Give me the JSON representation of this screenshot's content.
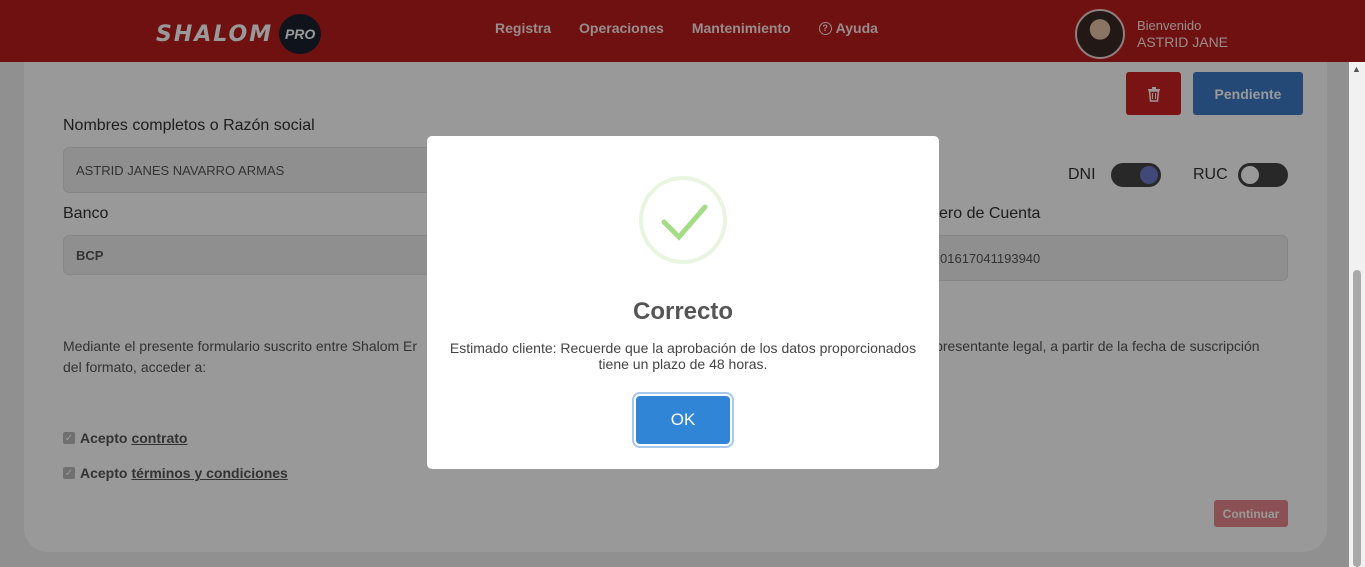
{
  "header": {
    "logo_text": "SHALOM",
    "logo_badge": "PRO",
    "nav": [
      "Registra",
      "Operaciones",
      "Mantenimiento",
      "Ayuda"
    ],
    "help_icon": "question-circle-icon",
    "welcome": "Bienvenido",
    "username": "ASTRID JANE",
    "bg_color": "#b91d1d"
  },
  "form": {
    "delete_icon": "trash-icon",
    "pending_button": "Pendiente",
    "name_label": "Nombres completos o Razón social",
    "name_value": "ASTRID JANES NAVARRO ARMAS",
    "dni_label": "DNI",
    "ruc_label": "RUC",
    "dni_on": true,
    "ruc_on": false,
    "bank_label": "Banco",
    "bank_value": "BCP",
    "account_label": "ero de Cuenta",
    "account_value": "01617041193940",
    "description_left": "Mediante el presente formulario suscrito entre Shalom Er",
    "description_right": "presentante legal, a partir de la fecha de suscripción",
    "description_line2": "del formato, acceder a:",
    "accept_prefix": "Acepto",
    "accept_contract_link": "contrato",
    "accept_terms_link": "términos y condiciones",
    "continue_button": "Continuar"
  },
  "modal": {
    "icon": "success-check-icon",
    "title": "Correcto",
    "text": "Estimado cliente: Recuerde que la aprobación de los datos proporcionados tiene un plazo de 48 horas.",
    "ok_button": "OK",
    "accent": "#3085d6"
  }
}
